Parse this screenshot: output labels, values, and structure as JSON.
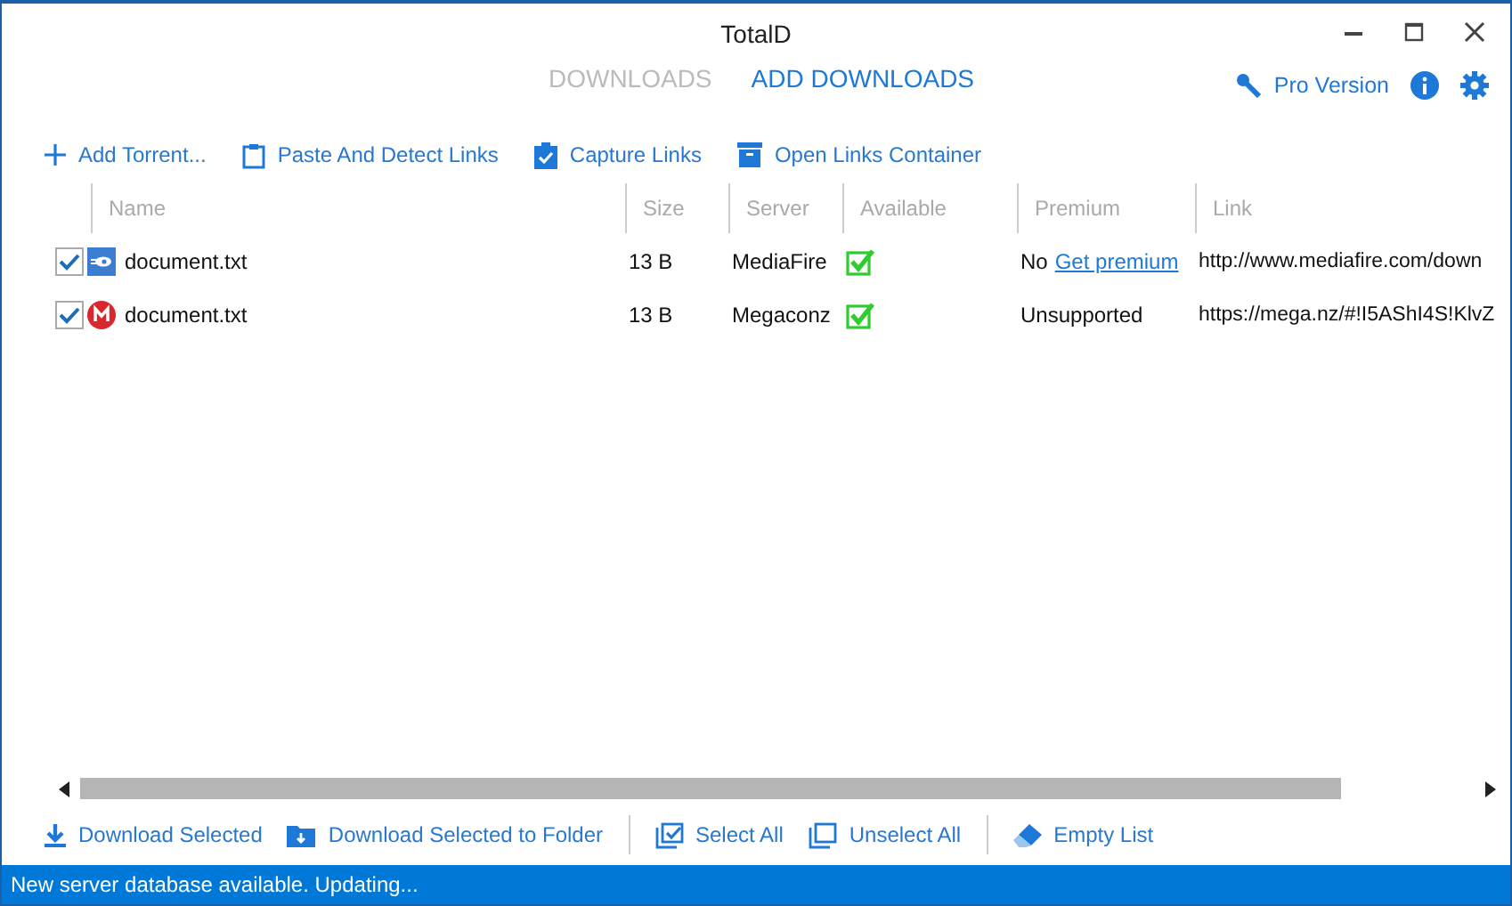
{
  "window": {
    "title": "TotalD"
  },
  "tabs": [
    {
      "label": "DOWNLOADS",
      "selected": false
    },
    {
      "label": "ADD DOWNLOADS",
      "selected": true
    }
  ],
  "pro_version": "Pro Version",
  "toolbar": [
    {
      "kind": "plus",
      "label": "Add Torrent..."
    },
    {
      "kind": "clipboard",
      "label": "Paste And Detect Links"
    },
    {
      "kind": "capture",
      "label": "Capture Links"
    },
    {
      "kind": "archive",
      "label": "Open Links Container"
    }
  ],
  "table": {
    "columns": [
      "Name",
      "Size",
      "Server",
      "Available",
      "Premium",
      "Link"
    ],
    "rows": [
      {
        "checked": true,
        "kind": "mediafire",
        "name": "document.txt",
        "size": "13 B",
        "server": "MediaFire",
        "available": true,
        "premium": "No",
        "premium_link": "Get premium",
        "link": "http://www.mediafire.com/down"
      },
      {
        "checked": true,
        "kind": "mega",
        "name": "document.txt",
        "size": "13 B",
        "server": "Megaconz",
        "available": true,
        "premium": "Unsupported",
        "link": "https://mega.nz/#!I5AShI4S!KlvZ"
      }
    ]
  },
  "bottom_toolbar": [
    {
      "kind": "download",
      "label": "Download Selected"
    },
    {
      "kind": "folder",
      "label": "Download Selected to Folder"
    },
    {
      "kind": "select",
      "label": "Select All"
    },
    {
      "kind": "unselect",
      "label": "Unselect All"
    },
    {
      "kind": "eraser",
      "label": "Empty List"
    }
  ],
  "status_bar": "New server database available. Updating..."
}
